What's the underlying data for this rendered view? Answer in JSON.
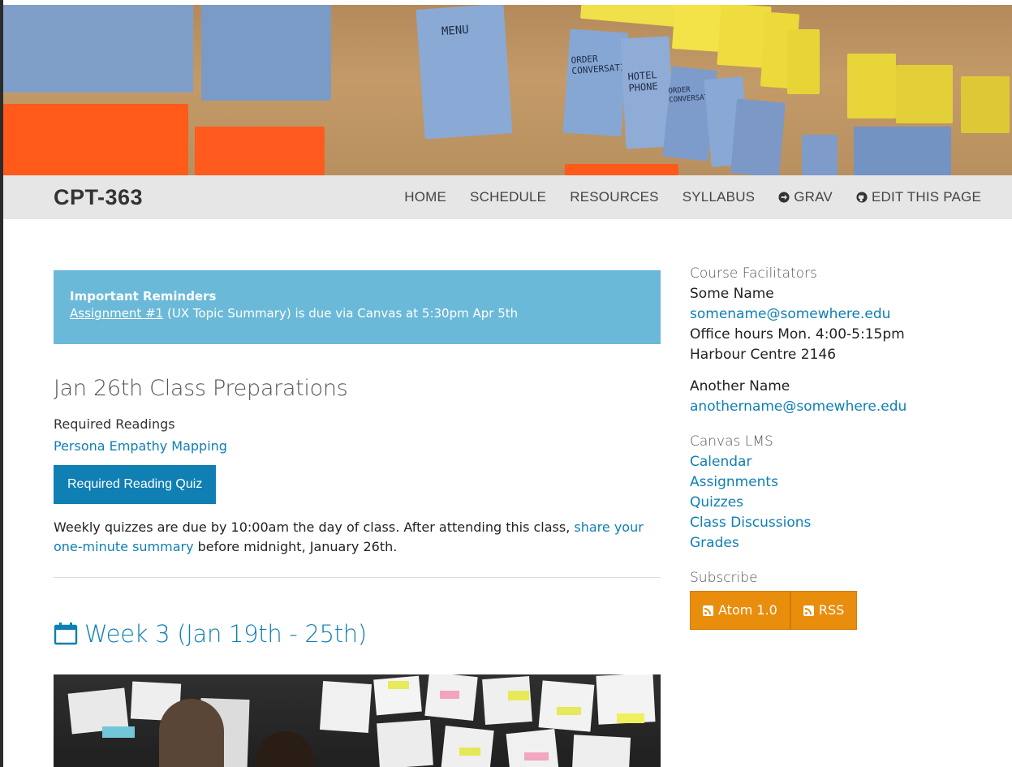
{
  "header": {
    "brand": "CPT-363",
    "nav": [
      {
        "label": "HOME",
        "icon": null
      },
      {
        "label": "SCHEDULE",
        "icon": null
      },
      {
        "label": "RESOURCES",
        "icon": null
      },
      {
        "label": "SYLLABUS",
        "icon": null
      },
      {
        "label": "GRAV",
        "icon": "arrow-circle-right-icon"
      },
      {
        "label": "EDIT THIS PAGE",
        "icon": "github-icon"
      }
    ]
  },
  "banner": {
    "notes": [
      "MENU",
      "ORDER CONVERSATION",
      "HOTEL PHONE",
      "ORDER CONVERSATION"
    ]
  },
  "alert": {
    "title": "Important Reminders",
    "link_text": "Assignment #1",
    "rest_text": " (UX Topic Summary) is due via Canvas at 5:30pm Apr 5th"
  },
  "prep": {
    "title": "Jan 26th Class Preparations",
    "readings_label": "Required Readings",
    "reading_link": "Persona Empathy Mapping",
    "quiz_button": "Required Reading Quiz",
    "weekly_text_before": "Weekly quizzes are due by 10:00am the day of class. After attending this class, ",
    "weekly_link": "share your one-minute summary",
    "weekly_text_after": " before midnight, January 26th."
  },
  "week": {
    "title": "Week 3 (Jan 19th - 25th)",
    "icon": "calendar-icon"
  },
  "sidebar": {
    "facilitators_heading": "Course Facilitators",
    "facilitator1": {
      "name": "Some Name",
      "email": "somename@somewhere.edu",
      "hours": "Office hours Mon. 4:00-5:15pm",
      "location": "Harbour Centre 2146"
    },
    "facilitator2": {
      "name": "Another Name",
      "email": "anothername@somewhere.edu"
    },
    "canvas_heading": "Canvas LMS",
    "canvas_links": [
      "Calendar",
      "Assignments",
      "Quizzes",
      "Class Discussions",
      "Grades"
    ],
    "subscribe_heading": "Subscribe",
    "subscribe_buttons": [
      "Atom 1.0",
      "RSS"
    ]
  },
  "colors": {
    "accent": "#0f7fb4",
    "alert_bg": "#6bb9d8",
    "subscribe_bg": "#e98d0d",
    "navbar_bg": "#e6e6e6"
  }
}
